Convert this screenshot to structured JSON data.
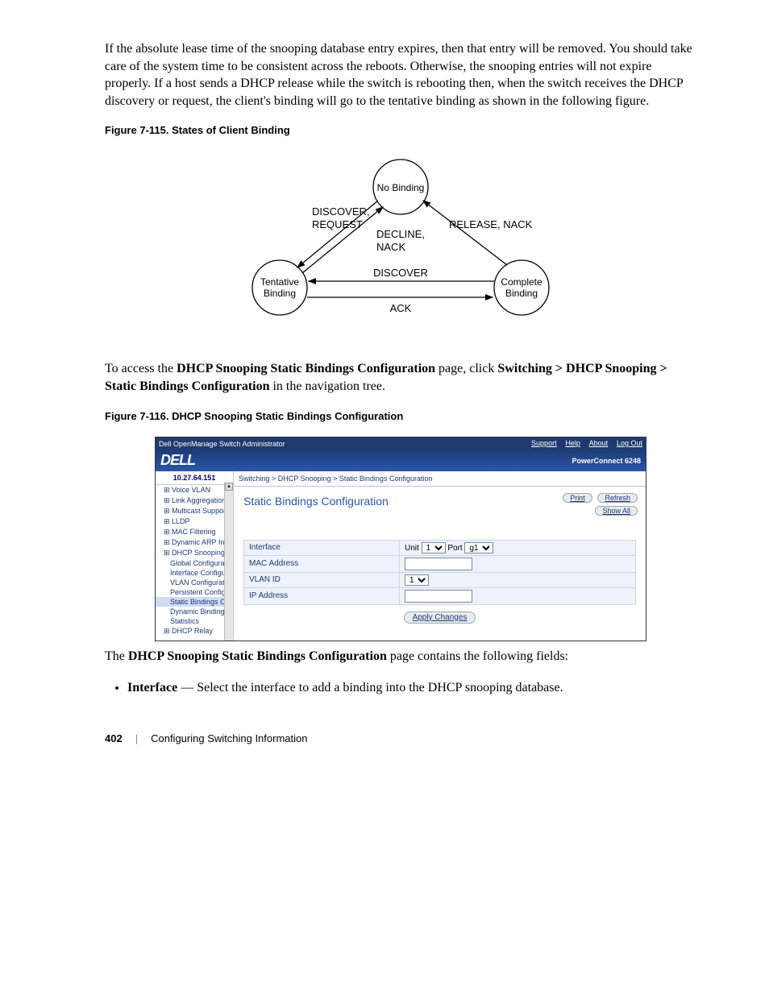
{
  "para1": "If the absolute lease time of the snooping database entry expires, then that entry will be removed. You should take care of the system time to be consistent across the reboots. Otherwise, the snooping entries will not expire properly. If a host sends a DHCP release while the switch is rebooting then, when the switch receives the DHCP discovery or request, the client's binding will go to the tentative binding as shown in the following figure.",
  "fig115": "Figure 7-115.    States of Client Binding",
  "diagram": {
    "no_binding": "No Binding",
    "tentative": "Tentative",
    "tentative2": "Binding",
    "complete": "Complete",
    "complete2": "Binding",
    "discover_request1": "DISCOVER,",
    "discover_request2": "REQUEST",
    "decline1": "DECLINE,",
    "decline2": "NACK",
    "release": "RELEASE, NACK",
    "discover_mid": "DISCOVER",
    "ack": "ACK"
  },
  "para2_pre": "To access the ",
  "para2_b1": "DHCP Snooping Static Bindings Configuration",
  "para2_mid": " page, click ",
  "para2_b2": "Switching > DHCP Snooping > Static Bindings Configuration",
  "para2_post": " in the navigation tree.",
  "fig116": "Figure 7-116.    DHCP Snooping Static Bindings Configuration",
  "screenshot": {
    "topbar_title": "Dell OpenManage Switch Administrator",
    "top_links": [
      "Support",
      "Help",
      "About",
      "Log Out"
    ],
    "logo": "DELL",
    "model": "PowerConnect 6248",
    "ip": "10.27.64.151",
    "nav": [
      {
        "l": "Voice VLAN",
        "cls": ""
      },
      {
        "l": "Link Aggregation",
        "cls": ""
      },
      {
        "l": "Multicast Support",
        "cls": ""
      },
      {
        "l": "LLDP",
        "cls": ""
      },
      {
        "l": "MAC Filtering",
        "cls": ""
      },
      {
        "l": "Dynamic ARP Inspe",
        "cls": ""
      },
      {
        "l": "DHCP Snooping",
        "cls": ""
      },
      {
        "l": "Global Configurat",
        "cls": "l2"
      },
      {
        "l": "Interface Configu",
        "cls": "l2"
      },
      {
        "l": "VLAN Configurati",
        "cls": "l2"
      },
      {
        "l": "Persistent Config",
        "cls": "l2"
      },
      {
        "l": "Static Bindings C",
        "cls": "l2 sel"
      },
      {
        "l": "Dynamic Binding",
        "cls": "l2"
      },
      {
        "l": "Statistics",
        "cls": "l2"
      },
      {
        "l": "DHCP Relay",
        "cls": ""
      }
    ],
    "breadcrumb": "Switching > DHCP Snooping > Static Bindings Configuration",
    "panel_title": "Static Bindings Configuration",
    "print": "Print",
    "refresh": "Refresh",
    "showall": "Show All",
    "rows": {
      "interface": "Interface",
      "unit_lab": "Unit",
      "unit_val": "1",
      "port_lab": "Port",
      "port_val": "g1",
      "mac": "MAC Address",
      "vlan": "VLAN ID",
      "vlan_val": "1",
      "ip": "IP Address"
    },
    "apply": "Apply Changes"
  },
  "para3_pre": "The ",
  "para3_b": "DHCP Snooping Static Bindings Configuration",
  "para3_post": " page contains the following fields:",
  "field_b": "Interface",
  "field_rest": " — Select the interface to add a binding into the DHCP snooping database.",
  "footer_page": "402",
  "footer_sep": "|",
  "footer_title": "Configuring Switching Information"
}
